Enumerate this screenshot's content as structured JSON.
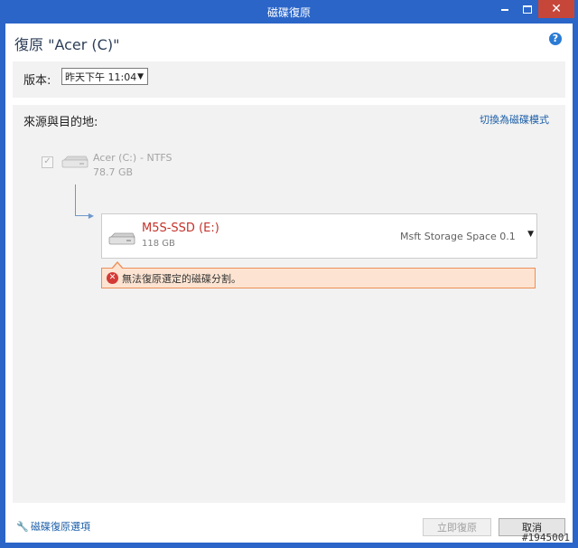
{
  "window": {
    "title": "磁碟復原",
    "close_glyph": "✕"
  },
  "header": {
    "page_title": "復原 \"Acer (C)\"",
    "help_glyph": "?"
  },
  "version": {
    "label": "版本:",
    "selected": "昨天下午 11:04"
  },
  "section": {
    "title": "來源與目的地:",
    "switch_link": "切換為磁碟模式"
  },
  "source": {
    "checked": true,
    "name": "Acer (C:)",
    "size": "78.7 GB",
    "filesystem": "- NTFS"
  },
  "target": {
    "name": "M5S-SSD (E:)",
    "size": "118 GB",
    "type": "Msft Storage Space 0.1"
  },
  "error": {
    "message": "無法復原選定的磁碟分割。"
  },
  "footer": {
    "options_link": "磁碟復原選項",
    "restore_button": "立即復原",
    "cancel_button": "取消"
  },
  "watermark": "#1945001",
  "icons": {
    "help": "help-icon",
    "error": "error-icon",
    "wrench": "wrench-icon",
    "disk": "hard-drive-icon"
  }
}
